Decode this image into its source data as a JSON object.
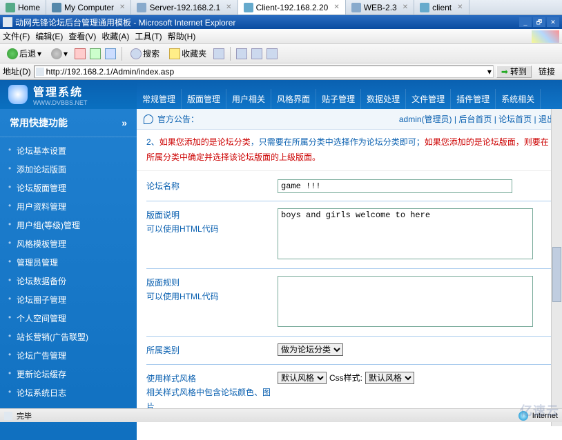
{
  "vm_tabs": [
    {
      "label": "Home",
      "icon": "ico-home",
      "active": false,
      "closable": false
    },
    {
      "label": "My Computer",
      "icon": "ico-pc",
      "active": false,
      "closable": true
    },
    {
      "label": "Server-192.168.2.1",
      "icon": "ico-srv",
      "active": false,
      "closable": true
    },
    {
      "label": "Client-192.168.2.20",
      "icon": "ico-cli",
      "active": true,
      "closable": true
    },
    {
      "label": "WEB-2.3",
      "icon": "ico-srv",
      "active": false,
      "closable": true
    },
    {
      "label": "client",
      "icon": "ico-cli",
      "active": false,
      "closable": true
    }
  ],
  "ie": {
    "title": "动网先锋论坛后台管理通用模板 - Microsoft Internet Explorer",
    "menus": [
      "文件(F)",
      "编辑(E)",
      "查看(V)",
      "收藏(A)",
      "工具(T)",
      "帮助(H)"
    ],
    "toolbar": {
      "back": "后退",
      "search": "搜索",
      "favs": "收藏夹"
    },
    "address_label": "地址(D)",
    "address": "http://192.168.2.1/Admin/index.asp",
    "go": "转到",
    "links": "链接",
    "status_done": "完毕",
    "status_zone": "Internet"
  },
  "admin": {
    "logo": "管理系统",
    "logo_url": "WWW.DVBBS.NET",
    "nav": [
      "常规管理",
      "版面管理",
      "用户相关",
      "风格界面",
      "贴子管理",
      "数据处理",
      "文件管理",
      "插件管理",
      "系统相关"
    ]
  },
  "sidebar": {
    "title": "常用快捷功能",
    "chevron": "»",
    "items": [
      "论坛基本设置",
      "添加论坛版面",
      "论坛版面管理",
      "用户资料管理",
      "用户组(等级)管理",
      "风格模板管理",
      "管理员管理",
      "论坛数据备份",
      "论坛圈子管理",
      "个人空间管理",
      "站长营销(广告联盟)",
      "论坛广告管理",
      "更新论坛缓存",
      "论坛系统日志"
    ]
  },
  "announce": {
    "label": "官方公告：",
    "user": "admin",
    "user_role": "(管理员)",
    "links": {
      "bhome": "后台首页",
      "forum": "论坛首页",
      "logout": "退出"
    }
  },
  "notice": {
    "line_prefix": "2、",
    "part_a": "如果您添加的是论坛分类",
    "part_b": "，只需要在所属分类中选择作为论坛分类即可；",
    "part_c": "如果您添加的是论坛版面，则要在所属分类中确定并选择该论坛版面的上级版面。"
  },
  "form": {
    "name_label": "论坛名称",
    "name_value": "game !!!",
    "desc_label": "版面说明",
    "desc_sub": "可以使用HTML代码",
    "desc_value": "boys and girls welcome to here",
    "rules_label": "版面规则",
    "rules_sub": "可以使用HTML代码",
    "rules_value": "",
    "cat_label": "所属类别",
    "cat_value": "做为论坛分类",
    "style_label": "使用样式风格",
    "style_sub": "相关样式风格中包含论坛颜色、图片",
    "style_default": "默认风格",
    "css_label": "Css样式:"
  },
  "watermark": "亿速云"
}
